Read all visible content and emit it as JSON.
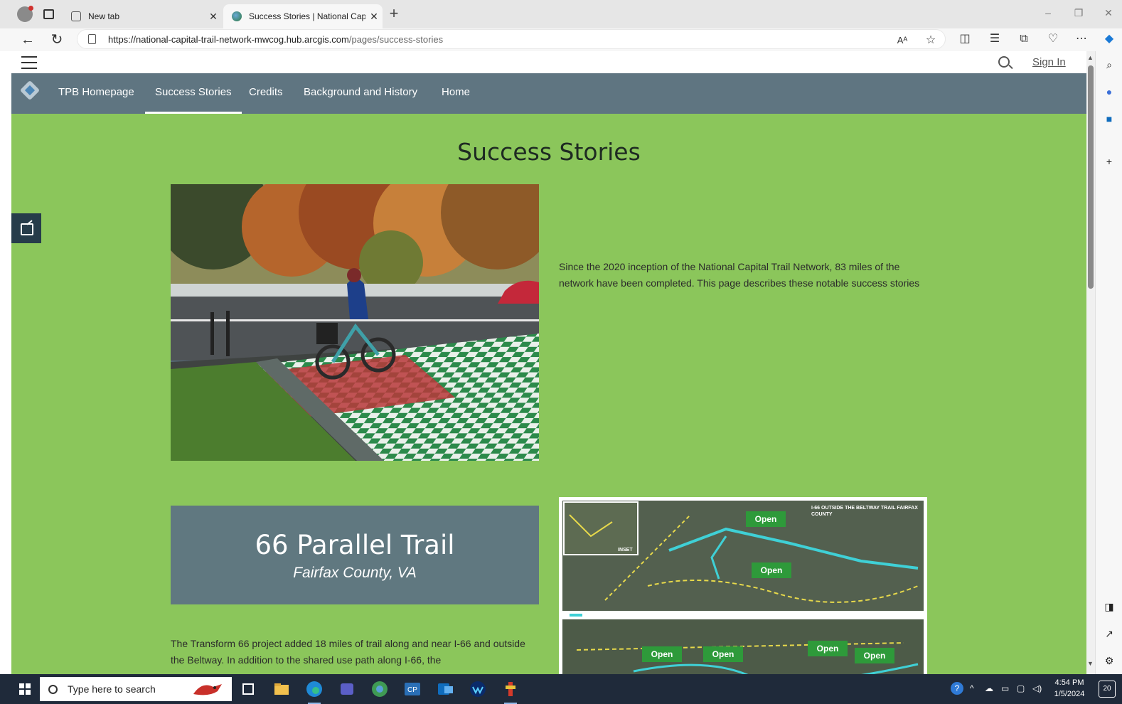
{
  "browser": {
    "tabs": [
      {
        "title": "New tab"
      },
      {
        "title": "Success Stories | National Capital"
      }
    ],
    "url_host": "https://national-capital-trail-network-mwcog.hub.arcgis.com",
    "url_path": "/pages/success-stories"
  },
  "site": {
    "signin_label": "Sign In",
    "nav": [
      "TPB Homepage",
      "Success Stories",
      "Credits",
      "Background and History",
      "Home"
    ],
    "active_nav": "Success Stories"
  },
  "content": {
    "page_title": "Success Stories",
    "intro": "Since the 2020 inception of the National Capital Trail Network, 83 miles of the network have been completed. This page describes these notable success stories",
    "story": {
      "title": "66 Parallel Trail",
      "subtitle": "Fairfax County, VA",
      "body": "The Transform 66 project added 18 miles of trail along and near I-66 and outside the Beltway. In addition to the shared use path along I-66, the"
    },
    "map": {
      "title": "I-66 OUTSIDE THE BELTWAY TRAIL FAIRFAX COUNTY",
      "inset_label": "INSET",
      "open_badges": [
        "Open",
        "Open",
        "Open",
        "Open",
        "Open",
        "Open"
      ]
    }
  },
  "taskbar": {
    "search_placeholder": "Type here to search",
    "time": "4:54 PM",
    "date": "1/5/2024",
    "notification_count": "20"
  },
  "colors": {
    "page_background": "#8bc65b",
    "nav_background": "#5f7581",
    "card_background": "#607880",
    "open_badge": "#2e9a3a",
    "trail_line": "#3fd0d6"
  }
}
